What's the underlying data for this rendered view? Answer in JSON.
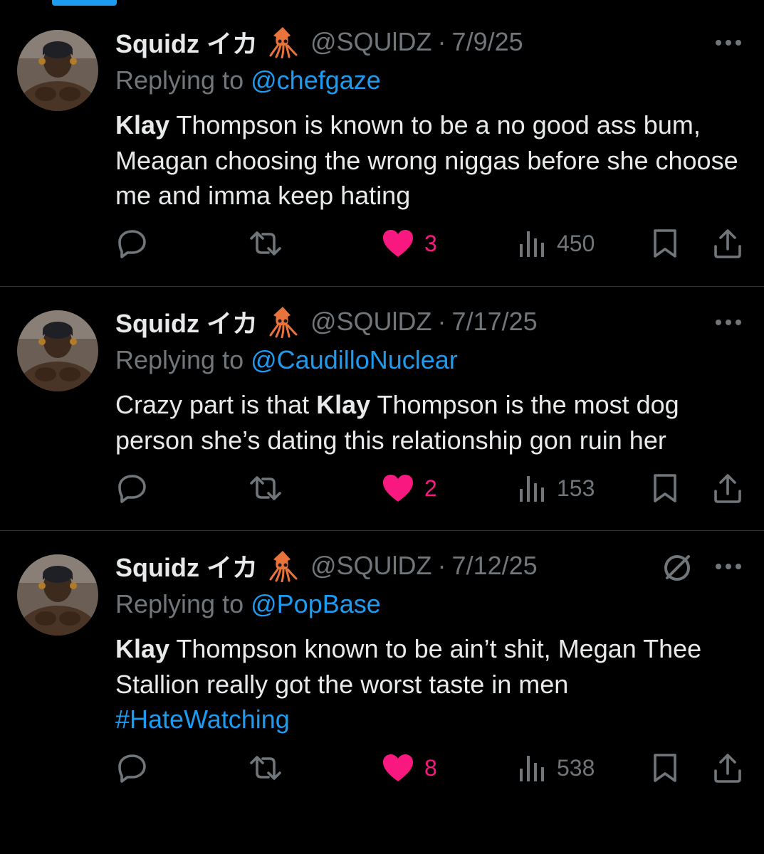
{
  "colors": {
    "background": "#000000",
    "text_primary": "#e7e9ea",
    "text_secondary": "#71767b",
    "link": "#1d9bf0",
    "like_active": "#f91880",
    "divider": "#2f3336"
  },
  "tweets": [
    {
      "display_name": "Squidz イカ",
      "display_emoji_icon": "squid-icon",
      "handle": "@SQUlDZ",
      "separator": "·",
      "date": "7/9/25",
      "replying_prefix": "Replying to",
      "replying_to": "@chefgaze",
      "text_parts": [
        {
          "text": "Klay",
          "style": "bold"
        },
        {
          "text": " Thompson is known to be a no good ass bum, Meagan choosing the wrong niggas before she choose me and imma keep hating",
          "style": "normal"
        }
      ],
      "likes": "3",
      "views": "450",
      "liked": true,
      "muted_icon": false
    },
    {
      "display_name": "Squidz イカ",
      "display_emoji_icon": "squid-icon",
      "handle": "@SQUlDZ",
      "separator": "·",
      "date": "7/17/25",
      "replying_prefix": "Replying to",
      "replying_to": "@CaudilloNuclear",
      "text_parts": [
        {
          "text": "Crazy part is that ",
          "style": "normal"
        },
        {
          "text": "Klay",
          "style": "bold"
        },
        {
          "text": " Thompson is the most dog person she’s dating this relationship gon ruin her",
          "style": "normal"
        }
      ],
      "likes": "2",
      "views": "153",
      "liked": true,
      "muted_icon": false
    },
    {
      "display_name": "Squidz イカ",
      "display_emoji_icon": "squid-icon",
      "handle": "@SQUlDZ",
      "separator": "·",
      "date": "7/12/25",
      "replying_prefix": "Replying to",
      "replying_to": "@PopBase",
      "text_parts": [
        {
          "text": "Klay",
          "style": "bold"
        },
        {
          "text": " Thompson known to be ain’t shit, Megan Thee Stallion really got the worst taste in men ",
          "style": "normal"
        },
        {
          "text": "#HateWatching",
          "style": "hashtag"
        }
      ],
      "likes": "8",
      "views": "538",
      "liked": true,
      "muted_icon": true
    }
  ]
}
